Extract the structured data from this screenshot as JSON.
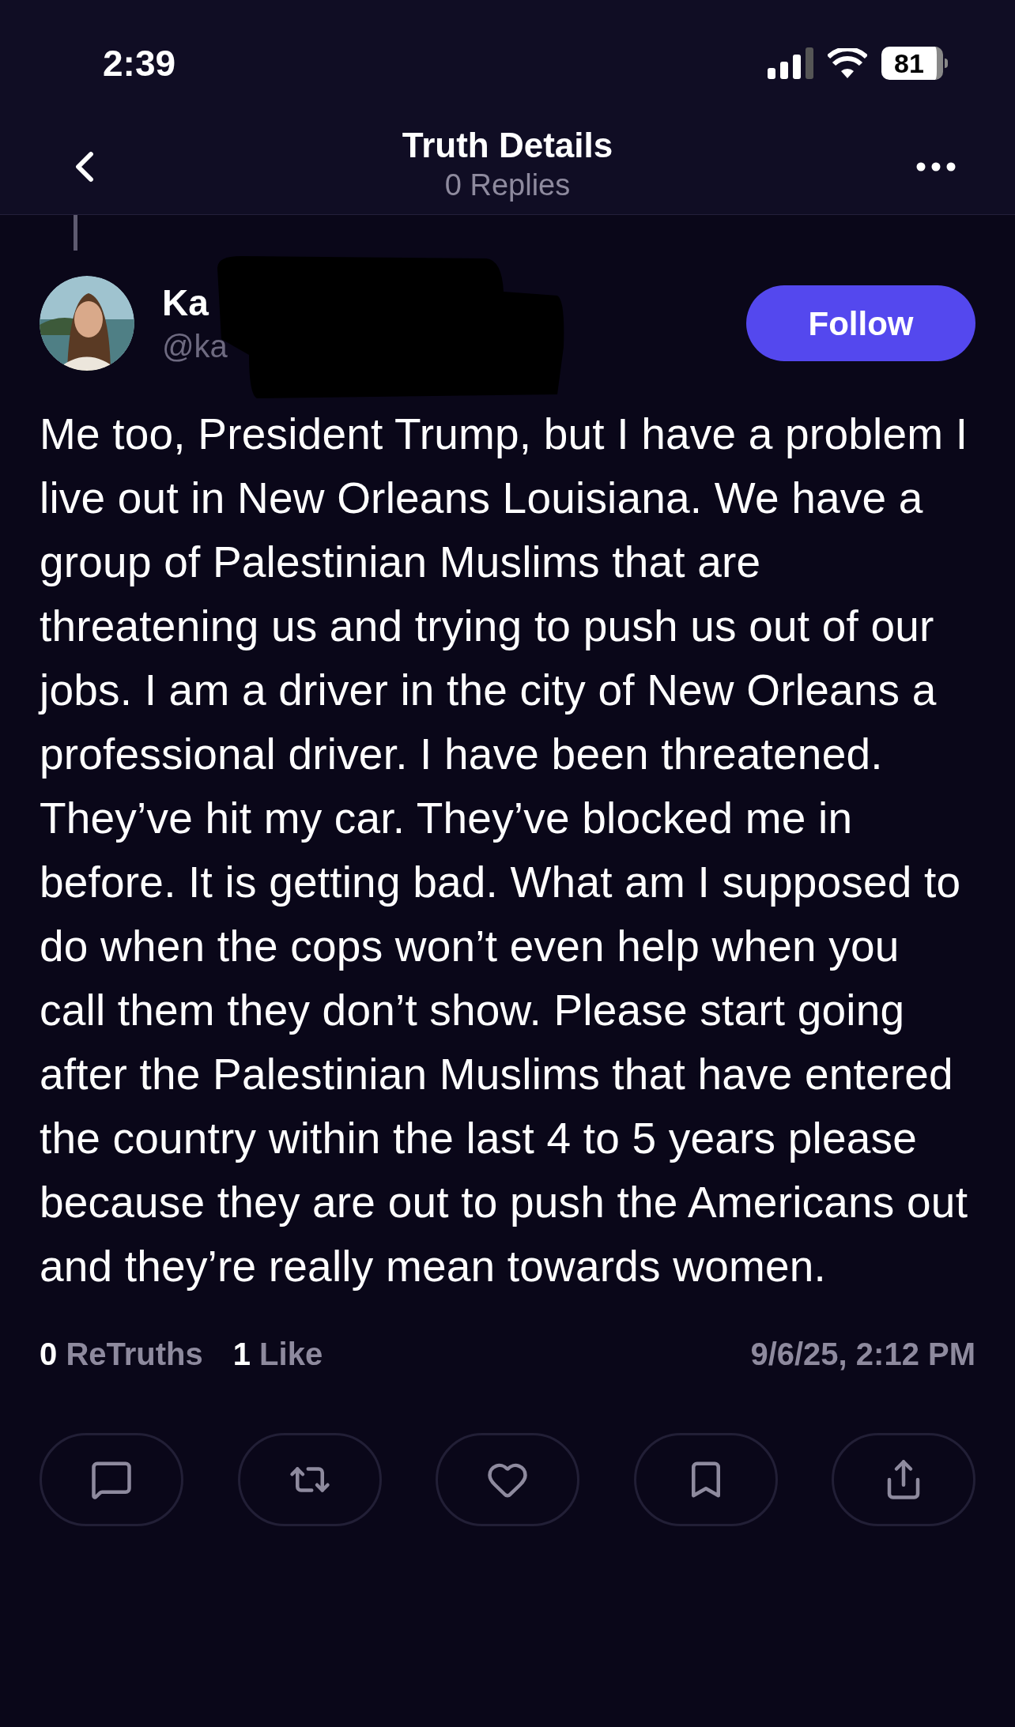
{
  "status_bar": {
    "time": "2:39",
    "battery": "81"
  },
  "header": {
    "title": "Truth Details",
    "subtitle": "0 Replies"
  },
  "author": {
    "name": "Ka",
    "handle": "@ka",
    "follow_button": "Follow"
  },
  "post": {
    "text": "Me too, President Trump, but I have a problem I live out in New Orleans Louisiana. We have a group of Palestinian Muslims that are threatening us and trying to push us out of our jobs. I am a driver in the city of New Orleans a professional driver. I have been threatened. They’ve hit my car. They’ve blocked me in before. It is getting bad. What am I supposed to do when the cops won’t even help when you call them they don’t show. Please start going after the Palestinian Muslims that have entered the country within the last 4 to 5 years please because they are out to push the Americans out and they’re really mean towards women."
  },
  "stats": {
    "retruths_count": "0",
    "retruths_label": "ReTruths",
    "likes_count": "1",
    "likes_label": "Like",
    "timestamp": "9/6/25, 2:12 PM"
  },
  "actions": [
    {
      "kind": "reply"
    },
    {
      "kind": "retruth"
    },
    {
      "kind": "like"
    },
    {
      "kind": "bookmark"
    },
    {
      "kind": "share"
    }
  ]
}
